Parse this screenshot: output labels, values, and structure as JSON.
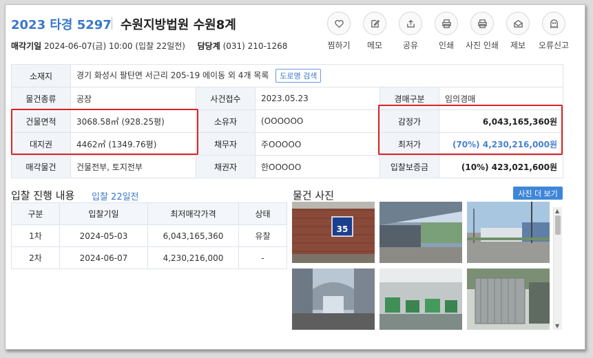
{
  "header": {
    "case_number": "2023 타경 5297",
    "court": "수원지방법원 수원8계",
    "auction_date_label": "매각기일",
    "auction_date_value": "2024-06-07(금) 10:00 (입찰 22일전)",
    "officer_label": "담당계",
    "officer_value": "(031) 210-1268"
  },
  "actions": [
    {
      "label": "찜하기",
      "icon": "heart-icon"
    },
    {
      "label": "메모",
      "icon": "memo-icon"
    },
    {
      "label": "공유",
      "icon": "share-icon"
    },
    {
      "label": "인쇄",
      "icon": "print-icon"
    },
    {
      "label": "사진 인쇄",
      "icon": "photo-print-icon"
    },
    {
      "label": "제보",
      "icon": "report-icon"
    },
    {
      "label": "오류신고",
      "icon": "ghost-icon"
    }
  ],
  "info": {
    "location_label": "소재지",
    "location_value": "경기 화성시 팔탄면 서근리 205-19 에이동 외 4개 목록",
    "road_search_label": "도로명 검색",
    "type_label": "물건종류",
    "type_value": "공장",
    "filed_label": "사건접수",
    "filed_value": "2023.05.23",
    "auction_type_label": "경매구분",
    "auction_type_value": "임의경매",
    "building_area_label": "건물면적",
    "building_area_value": "3068.58㎡ (928.25평)",
    "owner_label": "소유자",
    "owner_value": "(OOOOOO",
    "appraisal_label": "감정가",
    "appraisal_value": "6,043,165,360원",
    "land_right_label": "대지권",
    "land_right_value": "4462㎡ (1349.76평)",
    "debtor_label": "채무자",
    "debtor_value": "주OOOOO",
    "min_price_label": "최저가",
    "min_price_value": "(70%) 4,230,216,000원",
    "sale_item_label": "매각물건",
    "sale_item_value": "건물전부, 토지전부",
    "creditor_label": "채권자",
    "creditor_value": "한OOOOO",
    "deposit_label": "입찰보증금",
    "deposit_value": "(10%) 423,021,600원"
  },
  "bid_section": {
    "title": "입찰 진행 내용",
    "subtitle": "입찰 22일전",
    "columns": [
      "구분",
      "입찰기일",
      "최저매각가격",
      "상태"
    ],
    "rows": [
      [
        "1차",
        "2024-05-03",
        "6,043,165,360",
        "유찰"
      ],
      [
        "2차",
        "2024-06-07",
        "4,230,216,000",
        "-"
      ]
    ]
  },
  "photo_section": {
    "title": "물건 사진",
    "more_label": "사진 더 보기",
    "sign_number": "35"
  },
  "colors": {
    "accent_blue": "#3a78c9",
    "highlight_red": "#e02020",
    "header_cell_bg": "#f1f5fa"
  }
}
